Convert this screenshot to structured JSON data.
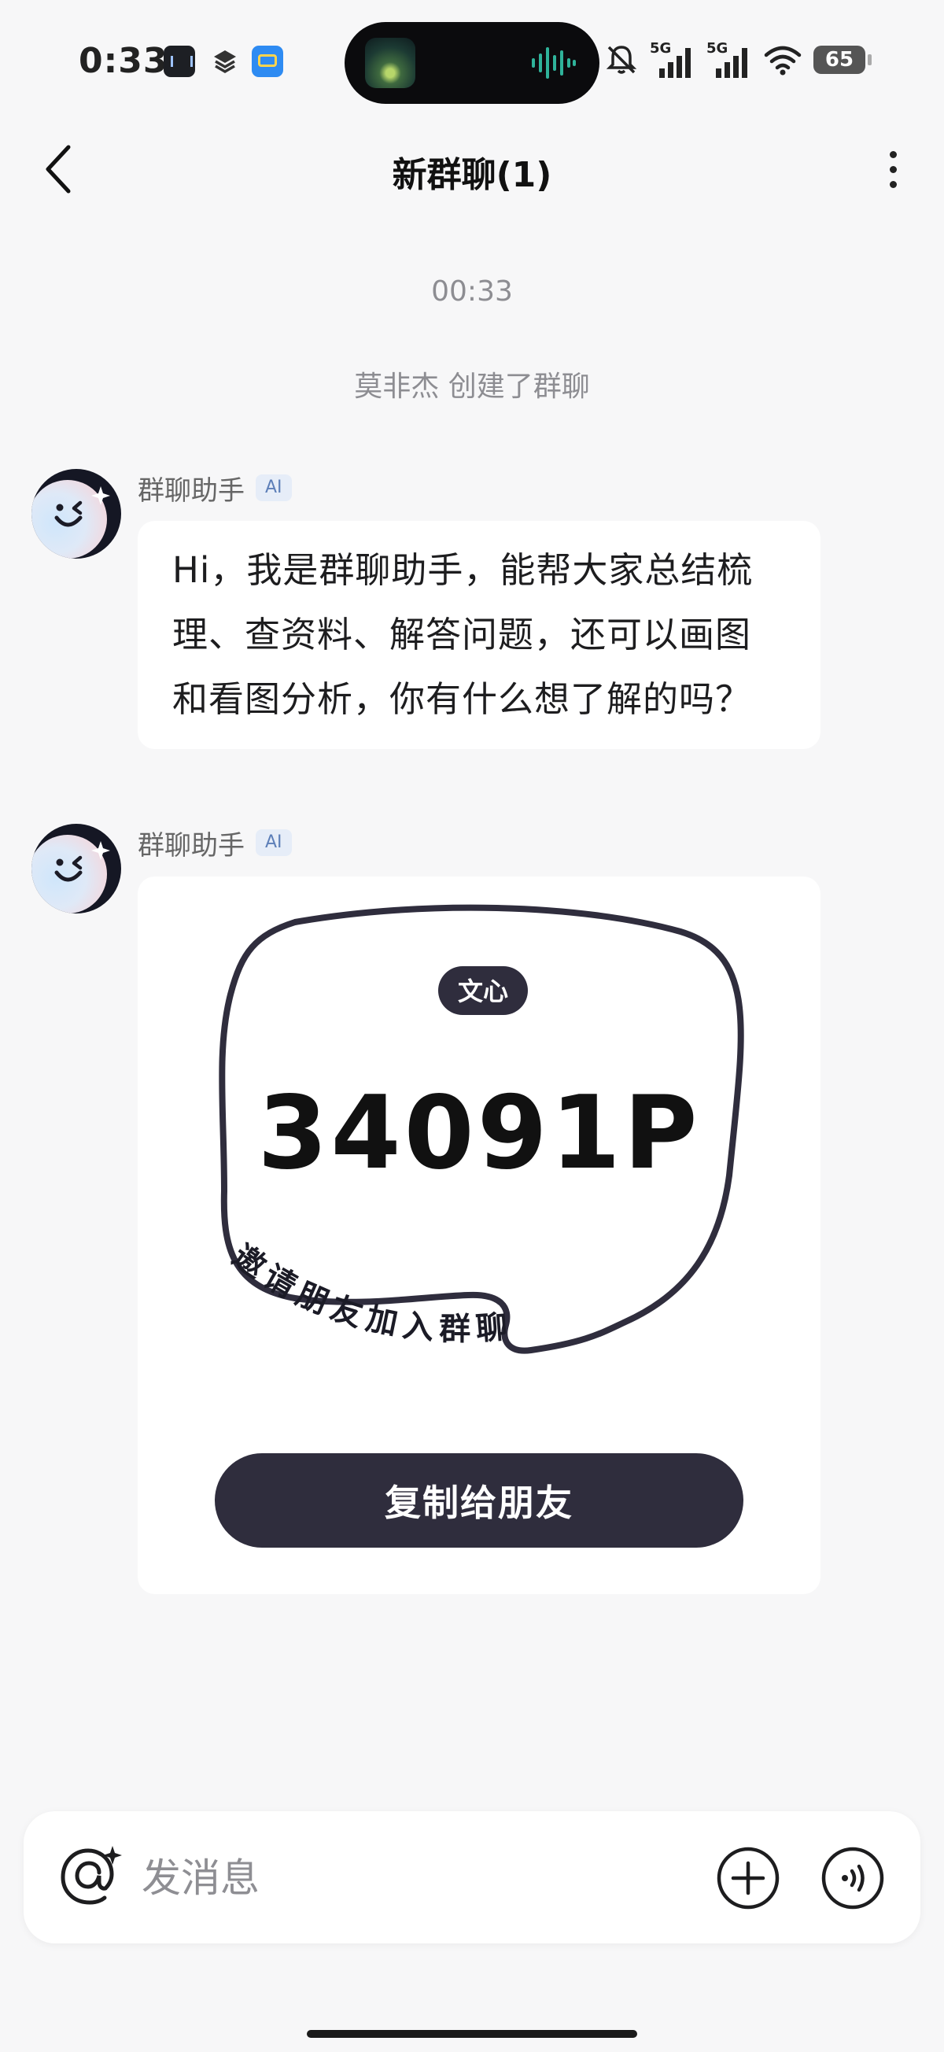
{
  "status_bar": {
    "time": "0:33",
    "network_1": "5G",
    "network_2": "5G",
    "battery": "65",
    "app_icons": [
      "podcast-app-icon",
      "layers-app-icon",
      "wallet-app-icon"
    ],
    "status_icons": [
      "mute-bell-icon",
      "signal-icon",
      "signal-icon",
      "wifi-icon",
      "battery-icon"
    ]
  },
  "header": {
    "title": "新群聊(1)",
    "back_icon": "chevron-left-icon",
    "more_icon": "more-vertical-icon"
  },
  "chat": {
    "timestamp": "00:33",
    "system_message": "莫非杰 创建了群聊",
    "messages": [
      {
        "sender": "群聊助手",
        "badge": "AI",
        "lines": [
          "Hi，我是群聊助手，能帮大家总结梳",
          "理、查资料、解答问题，还可以画图",
          "和看图分析，你有什么想了解的吗？"
        ]
      },
      {
        "sender": "群聊助手",
        "badge": "AI",
        "card": {
          "brand": "文心",
          "code": "34091P",
          "curved_text": "邀请朋友加入群聊",
          "button": "复制给朋友"
        }
      }
    ]
  },
  "composer": {
    "placeholder": "发消息",
    "at_icon": "at-sparkle-icon",
    "plus_icon": "plus-circle-icon",
    "voice_icon": "voice-circle-icon"
  },
  "colors": {
    "background": "#f7f7f8",
    "bubble": "#ffffff",
    "card_dark": "#2f2d3d",
    "meta_text": "#8d8d92",
    "ai_badge_bg": "#e6edf8",
    "ai_badge_text": "#5d7fb8"
  }
}
